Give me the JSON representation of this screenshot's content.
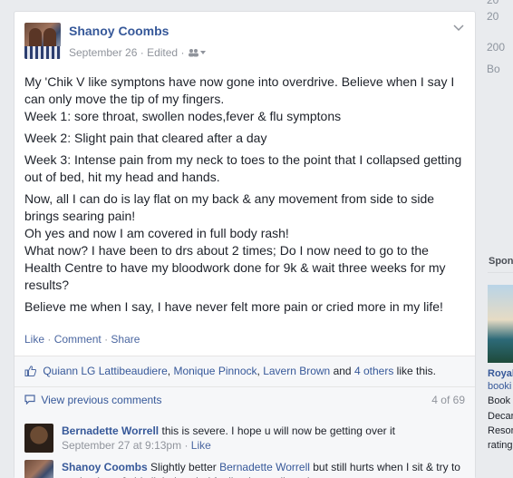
{
  "post": {
    "author": "Shanoy Coombs",
    "date": "September 26",
    "edited": "Edited",
    "paragraphs": [
      "My 'Chik V like symptons have now gone into overdrive. Believe when I say I can only move the tip of my fingers.",
      "Week 1: sore throat, swollen nodes,fever & flu symptons",
      "Week 2: Slight pain that cleared after a day",
      "Week 3: Intense pain from my neck to toes to the point that I collapsed getting out of bed, hit my head and hands.",
      "Now, all I can do is lay flat on my back & any movement from side to side brings searing pain!",
      "Oh yes and now I am covered in full body rash!",
      "What now? I have been to drs about 2 times; Do I now need to go to the Health Centre to have my bloodwork done for 9k & wait three weeks for my results?",
      "Believe me when I say, I have never felt more pain or cried more in my life!"
    ],
    "actions": {
      "like": "Like",
      "comment": "Comment",
      "share": "Share"
    },
    "likes": {
      "name1": "Quiann LG Lattibeaudiere",
      "name2": "Monique Pinnock",
      "name3": "Lavern Brown",
      "and": "and",
      "others": "4 others",
      "suffix": "like this."
    },
    "comments": {
      "view_previous": "View previous comments",
      "count": "4 of 69",
      "items": [
        {
          "name": "Bernadette Worrell",
          "text": "this is severe. I hope u will now be getting over it",
          "time": "September 27 at 9:13pm",
          "like": "Like"
        },
        {
          "name": "Shanoy Coombs",
          "text_before": "Slightly better",
          "mention": "Bernadette Worrell",
          "text_after": "but still hurts when I sit & try to get back up & this light headed feeling keeps lingering."
        }
      ]
    }
  },
  "sidebar": {
    "years": [
      "20",
      "20",
      "200",
      "Bo"
    ],
    "sponsored": "Spon",
    "ad_lines": [
      "Royal",
      "booki",
      "Book",
      "Decar",
      "Resor",
      "rating"
    ]
  }
}
